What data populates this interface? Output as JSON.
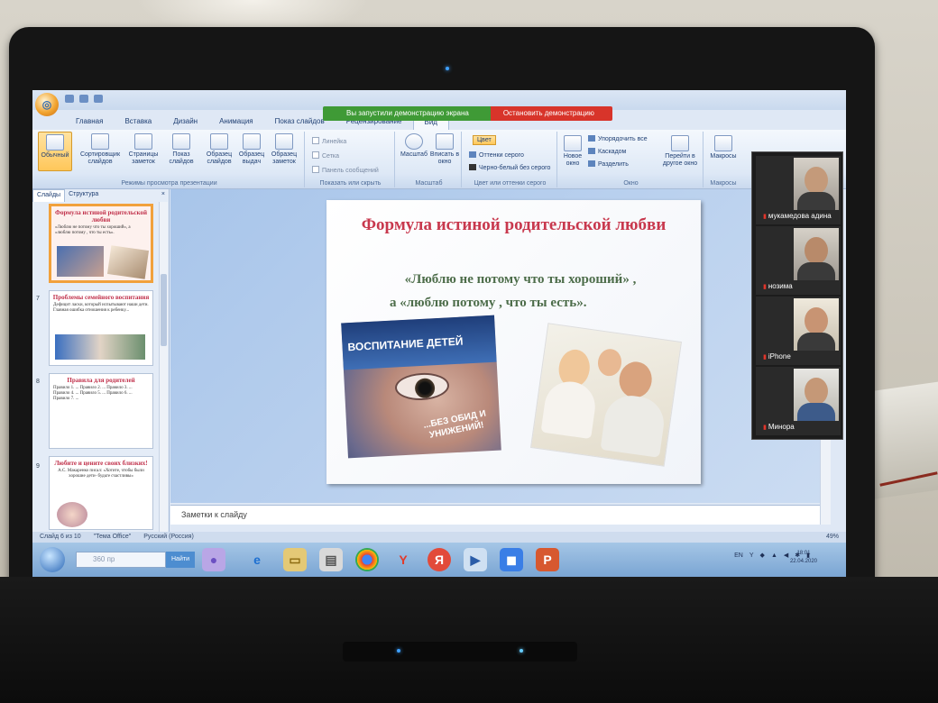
{
  "share_bar": {
    "message": "Вы запустили демонстрацию экрана",
    "stop_label": "Остановить демонстрацию"
  },
  "ribbon": {
    "tabs": [
      "Главная",
      "Вставка",
      "Дизайн",
      "Анимация",
      "Показ слайдов",
      "Рецензирование",
      "Вид"
    ],
    "active_tab": "Вид",
    "views": {
      "normal": "Обычный",
      "sorter": "Сортировщик слайдов",
      "notes_page": "Страницы заметок",
      "show": "Показ слайдов",
      "slide_master": "Образец слайдов",
      "handout_master": "Образец выдач",
      "notes_master": "Образец заметок",
      "group_label": "Режимы просмотра презентации"
    },
    "show_hide": {
      "ruler": "Линейка",
      "grid": "Сетка",
      "message_bar": "Панель сообщений",
      "group_label": "Показать или скрыть"
    },
    "zoom": {
      "zoom": "Масштаб",
      "fit": "Вписать в окно",
      "group_label": "Масштаб"
    },
    "color": {
      "color": "Цвет",
      "grayscale": "Оттенки серого",
      "bw": "Черно-белый без серого",
      "group_label": "Цвет или оттенки серого"
    },
    "window": {
      "new_window": "Новое окно",
      "arrange_all": "Упорядочить все",
      "cascade": "Каскадом",
      "split": "Разделить",
      "switch": "Перейти в другое окно",
      "group_label": "Окно"
    },
    "macros": {
      "macros": "Макросы",
      "group_label": "Макросы"
    }
  },
  "slides_panel": {
    "tab_slides": "Слайды",
    "tab_outline": "Структура",
    "close": "×",
    "thumbs": [
      {
        "num": "",
        "title": "Формула истиной родительской любви",
        "text": "«Люблю не потому что ты хороший», а «люблю потому , что ты есть»."
      },
      {
        "num": "7",
        "title": "Проблемы семейного воспитания",
        "text": "Дефицит ласки, который испытывают наши дети. Главная ошибка отношения к ребенку..."
      },
      {
        "num": "8",
        "title": "Правила для родителей",
        "text": "Правило 1. ... Правило 2. ... Правило 3. ... Правило 4. ... Правило 5. ... Правило 6. ... Правило 7. ..."
      },
      {
        "num": "9",
        "title": "Любите и цените своих близких!",
        "text": "А.С. Макаренко писал: «Хотите, чтобы были хорошие дети- будьте счастливы»"
      }
    ]
  },
  "slide": {
    "title": "Формула истиной родительской любви",
    "quote_line1": "«Люблю не потому что ты хороший» ,",
    "quote_line2": "а «люблю потому , что ты есть».",
    "image_left_caption_top": "ВОСПИТАНИЕ ДЕТЕЙ",
    "image_left_caption_bottom": "...БЕЗ ОБИД И УНИЖЕНИЙ!"
  },
  "notes_placeholder": "Заметки к слайду",
  "status": {
    "slide_info": "Слайд 6 из 10",
    "theme": "\"Тема Office\"",
    "language": "Русский (Россия)",
    "zoom": "49%"
  },
  "taskbar": {
    "search_placeholder": "360 пр",
    "search_button": "Найти",
    "tray_lang": "EN",
    "time": "18:01",
    "date": "22.04.2020"
  },
  "participants": [
    {
      "name": "мукамедова адина",
      "accent": "#e2352a"
    },
    {
      "name": "нозима",
      "accent": "#e2352a"
    },
    {
      "name": "iPhone",
      "accent": "#e2352a"
    },
    {
      "name": "Минора",
      "accent": "#e2352a"
    }
  ]
}
